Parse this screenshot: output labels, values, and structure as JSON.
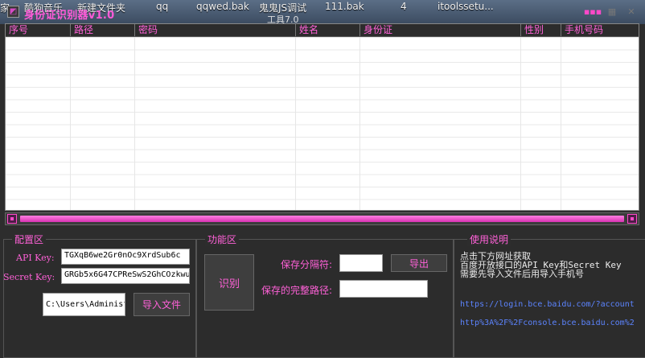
{
  "desktop": {
    "items": [
      "家",
      "酷狗音乐",
      "新建文件夹",
      "qq",
      "qqwed.bak",
      "鬼鬼JS调试",
      "111.bak",
      "4",
      "itoolssetu..."
    ],
    "sub": "工具7.0"
  },
  "window": {
    "title": "身份证识别器v1.0",
    "controls": {
      "menu": "▪▪▪",
      "minimize": "▦",
      "close": "✕"
    }
  },
  "grid": {
    "columns": [
      "序号",
      "路径",
      "密码",
      "姓名",
      "身份证",
      "性别",
      "手机号码"
    ]
  },
  "config": {
    "title": "配置区",
    "api_key_label": "API Key:",
    "api_key_value": "TGXqB6we2Gr0nOc9XrdSub6c",
    "secret_key_label": "Secret Key:",
    "secret_key_value": "GRGb5x6G47CPReSwS2GhCOzkwu",
    "file_path_value": "C:\\Users\\Administ",
    "import_button": "导入文件"
  },
  "function": {
    "title": "功能区",
    "recognize_button": "识别",
    "separator_label": "保存分隔符:",
    "separator_value": "",
    "export_button": "导出",
    "save_path_label": "保存的完整路径:",
    "save_path_value": ""
  },
  "usage": {
    "title": "使用说明",
    "line1": "点击下方网址获取",
    "line2": "百度开放接口的API Key和Secret Key",
    "line3": "需要先导入文件后用导入手机号",
    "link1": "https://login.bce.baidu.com/?account",
    "link2": "http%3A%2F%2Fconsole.bce.baidu.com%2"
  },
  "colors": {
    "accent": "#ff61d8",
    "link": "#5c84ff"
  }
}
